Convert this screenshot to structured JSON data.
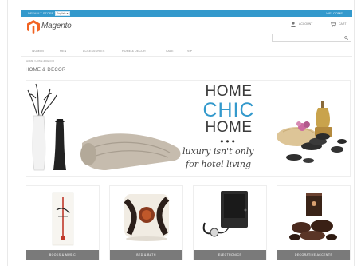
{
  "header": {
    "language_label": "DEFAULT STORE VIEW",
    "language_value": "English",
    "welcome": "WELCOME",
    "logo_text": "Magento",
    "account_label": "ACCOUNT",
    "cart_label": "CART",
    "search_placeholder": ""
  },
  "nav": {
    "items": [
      {
        "label": "WOMEN"
      },
      {
        "label": "MEN"
      },
      {
        "label": "ACCESSORIES"
      },
      {
        "label": "HOME & DECOR"
      },
      {
        "label": "SALE"
      },
      {
        "label": "VIP"
      }
    ]
  },
  "breadcrumb": "HOME / HOME & DECOR",
  "page_title": "HOME & DECOR",
  "banner": {
    "line1": "HOME",
    "line2": "CHIC",
    "line3": "HOME",
    "dots": "•••",
    "tagline1": "luxury isn't only",
    "tagline2": "for hotel living"
  },
  "categories": [
    {
      "label": "BOOKS & MUSIC"
    },
    {
      "label": "BED & BATH"
    },
    {
      "label": "ELECTRONICS"
    },
    {
      "label": "DECORATIVE ACCENTS"
    }
  ],
  "colors": {
    "accent": "#3399cc",
    "label_bg": "#7a7a7a"
  }
}
